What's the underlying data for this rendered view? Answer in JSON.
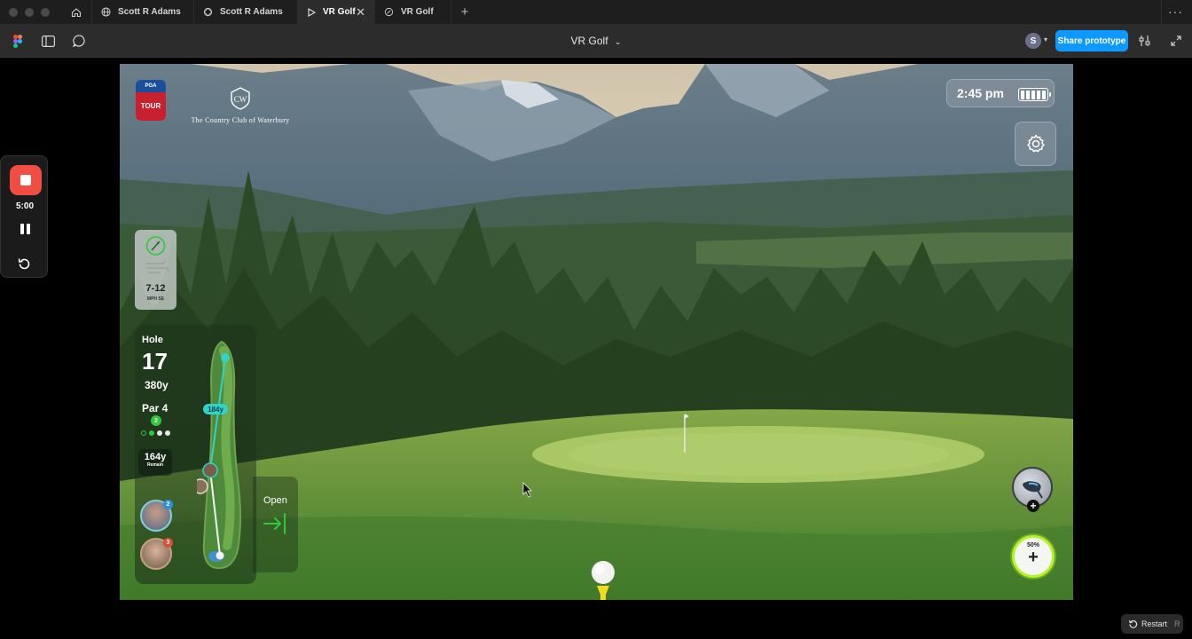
{
  "tabs": [
    {
      "label": "Scott R Adams",
      "icon": "globe-icon"
    },
    {
      "label": "Scott R Adams",
      "icon": "figma-draft-icon"
    },
    {
      "label": "VR Golf",
      "icon": "play-icon",
      "active": true
    },
    {
      "label": "VR Golf",
      "icon": "figma-draft-icon"
    }
  ],
  "toolbar": {
    "title": "VR Golf",
    "avatar_initial": "S",
    "share_label": "Share prototype"
  },
  "recorder": {
    "time": "5:00"
  },
  "game": {
    "club_name": "The Country Club of Waterbury",
    "tour_top": "PGA",
    "tour_bottom": "TOUR",
    "clock": "2:45 pm",
    "wind": {
      "speed": "7-12",
      "unit": "MPH SE"
    },
    "hole": {
      "label": "Hole",
      "number": "17",
      "yardage": "380y",
      "par": "Par 4",
      "par_badge": "2",
      "distance_marker": "184y",
      "remain_value": "164y",
      "remain_label": "Remain"
    },
    "players": [
      {
        "rank": "2",
        "rank_color": "#2f8fd8"
      },
      {
        "rank": "3",
        "rank_color": "#d8503a"
      }
    ],
    "open_label": "Open",
    "power_pct": "50%",
    "battery_level": 1.0
  },
  "footer": {
    "restart_label": "Restart",
    "restart_key": "R"
  },
  "colors": {
    "accent": "#0d99ff",
    "record": "#f24d43",
    "par_green": "#2fc93a",
    "hole_teal": "#2fd3c9",
    "power_lime": "#b7f02c"
  }
}
